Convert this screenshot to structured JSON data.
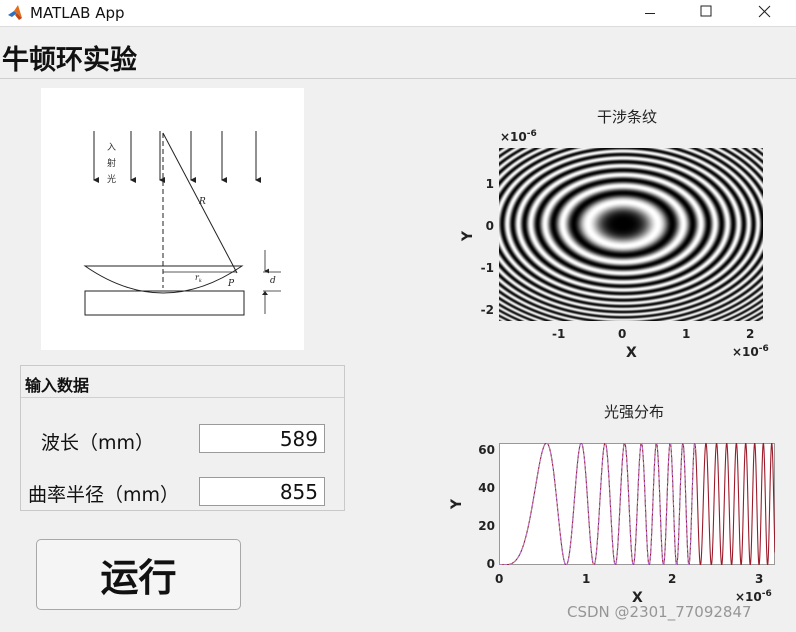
{
  "window": {
    "title": "MATLAB App"
  },
  "app": {
    "heading": "牛顿环实验"
  },
  "diagram": {
    "labels": {
      "incident": [
        "入",
        "射",
        "光"
      ],
      "R": "R",
      "rk": "r",
      "rk_sub": "k",
      "P": "P",
      "d": "d"
    }
  },
  "input_panel": {
    "title": "输入数据",
    "wavelength_label": "波长（mm）",
    "wavelength_value": "589",
    "radius_label": "曲率半径（mm）",
    "radius_value": "855"
  },
  "run_button": {
    "label": "运行"
  },
  "interference_plot": {
    "title": "干涉条纹",
    "xlabel": "X",
    "ylabel": "Y",
    "x_ticks": [
      "-1",
      "0",
      "1",
      "2"
    ],
    "y_ticks": [
      "1",
      "0",
      "-1",
      "-2"
    ],
    "x_exponent": "×10",
    "x_exponent_power": "-6",
    "y_exponent": "×10",
    "y_exponent_power": "-6"
  },
  "intensity_plot": {
    "title": "光强分布",
    "xlabel": "X",
    "ylabel": "Y",
    "x_ticks": [
      "0",
      "1",
      "2",
      "3"
    ],
    "y_ticks": [
      "60",
      "40",
      "20",
      "0"
    ],
    "x_exponent": "×10",
    "x_exponent_power": "-6"
  },
  "watermark": "CSDN @2301_77092847",
  "chart_data": [
    {
      "type": "heatmap",
      "title": "干涉条纹",
      "xlabel": "X",
      "ylabel": "Y",
      "xlim": [
        -1.95e-06,
        2.2e-06
      ],
      "ylim": [
        -2.3e-06,
        1.8e-06
      ],
      "x_ticks": [
        -1e-06,
        0,
        1e-06,
        2e-06
      ],
      "y_ticks": [
        -2e-06,
        -1e-06,
        0,
        1e-06
      ],
      "center": [
        0,
        0
      ],
      "colormap": "gray",
      "description_values": {
        "ring_pattern": "Newton rings intensity, I = 64·cos²(π·r²/(λR))"
      },
      "grid": false
    },
    {
      "type": "line",
      "title": "光强分布",
      "xlabel": "X",
      "ylabel": "Y",
      "xlim": [
        0,
        3.2e-06
      ],
      "ylim": [
        0,
        64
      ],
      "x_ticks": [
        0,
        1e-06,
        2e-06,
        3e-06
      ],
      "y_ticks": [
        0,
        20,
        40,
        60
      ],
      "peak_value": 64,
      "grid": false
    }
  ],
  "colors": {
    "window_bg": "#f0f0f0",
    "title_bar": "#ffffff",
    "plot_line_primary": "#9b1b2b",
    "plot_line_secondary": [
      "#e7b416",
      "#4c9f38",
      "#5e8fd8",
      "#c96ae0"
    ]
  }
}
